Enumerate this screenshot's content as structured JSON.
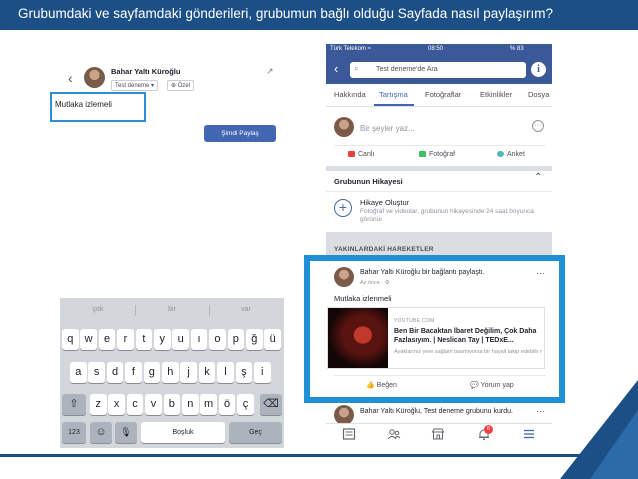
{
  "banner": {
    "title": "Grubumdaki ve sayfamdaki gönderileri, grubumun bağlı olduğu Sayfada nasıl paylaşırım?"
  },
  "composer": {
    "back_icon": "‹",
    "author_name": "Bahar Yaltı Küroğlu",
    "audience_label": "Test deneme ▾",
    "privacy_label": "Özel",
    "expand_icon": "↗",
    "input_text": "Mutlaka izlemeli",
    "share_button": "Şimdi Paylaş"
  },
  "keyboard": {
    "suggestions": [
      "çok",
      "bir",
      "var"
    ],
    "row1": [
      "q",
      "w",
      "e",
      "r",
      "t",
      "y",
      "u",
      "ı",
      "o",
      "p",
      "ğ",
      "ü"
    ],
    "row2": [
      "a",
      "s",
      "d",
      "f",
      "g",
      "h",
      "j",
      "k",
      "l",
      "ş",
      "i"
    ],
    "row3": [
      "z",
      "x",
      "c",
      "v",
      "b",
      "n",
      "m",
      "ö",
      "ç"
    ],
    "numbers_key": "123",
    "emoji_key": "☺",
    "mic_key": "🎙",
    "space_key": "Boşluk",
    "return_key": "Geç",
    "shift_key": "⇧",
    "delete_key": "⌫"
  },
  "phone": {
    "status_left": "Türk Telekom ≈",
    "status_time": "08:50",
    "status_right": "% 83",
    "search_text": "Test deneme'de Ara",
    "tabs": [
      "Hakkında",
      "Tartışma",
      "Fotoğraflar",
      "Etkinlikler",
      "Dosya"
    ],
    "composer_placeholder": "Bir şeyler yaz...",
    "actions": [
      "Canlı",
      "Fotoğraf",
      "Anket"
    ],
    "story_section_title": "Grubunun Hikayesi",
    "story_heading": "Hikaye Oluştur",
    "story_desc": "Fotoğraf ve videolar, grubunun hikayesinde 24 saat boyunca görünür",
    "recent_title": "YAKINLARDAKİ HAREKETLER",
    "shared_post": {
      "author": "Bahar Yaltı Küroğlu bir bağlantı paylaştı.",
      "time": "Az önce · ⚙",
      "text": "Mutlaka izlenmeli",
      "link_source": "YOUTUBE.COM",
      "link_title": "Ben Bir Bacaktan İbaret Değilim, Çok Daha Fazlasıyım. | Neslican Tay | TEDxE...",
      "link_desc": "Ayaklarınız yere sağlam basmıyorsa bir hayali takip edebilir misiniz?"
    },
    "like_label": "Beğen",
    "comment_label": "Yorum yap",
    "next_post_author": "Bahar Yaltı Küroğlu, Test deneme grubunu kurdu.",
    "notification_count": "6"
  },
  "colors": {
    "banner": "#1c4f86",
    "facebook_blue": "#3b5998",
    "highlight": "#1f8fd6"
  }
}
